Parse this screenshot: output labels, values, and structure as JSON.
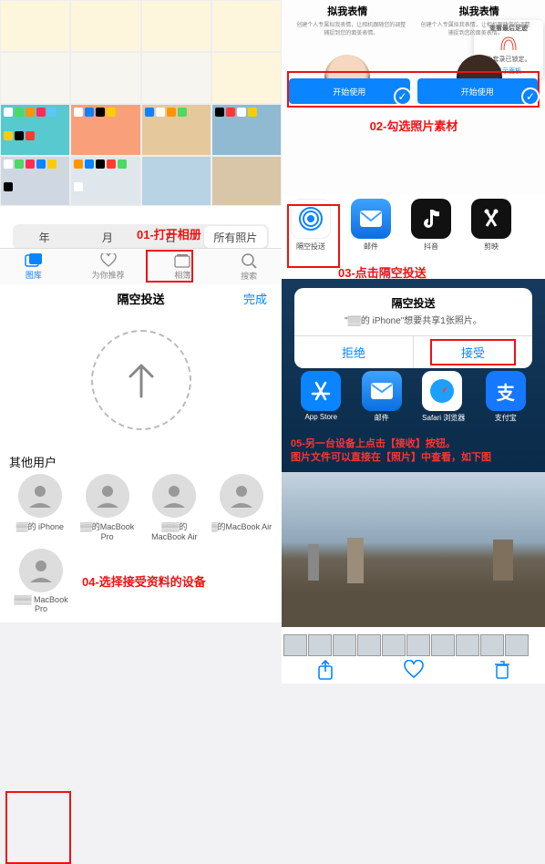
{
  "panel1": {
    "seg": {
      "year": "年",
      "month": "月",
      "day": "日",
      "all": "所有照片"
    },
    "tabs": {
      "library": "图库",
      "foryou": "为你推荐",
      "albums": "相簿",
      "search": "搜索"
    },
    "annot": "01-打开相册"
  },
  "panel2": {
    "memoji_title": "拟我表情",
    "memoji_desc": "创建个人专属拟我表情，让相机跟随您的调整捕捉到您的面美表情。",
    "btn_label": "开始使用",
    "popover_title": "查看最后足迹",
    "popover_body": "此套录已锁定。",
    "popover_link": "显示面板",
    "annot": "02-勾选照片素材"
  },
  "panel3": {
    "items": [
      {
        "name": "airdrop",
        "label": "隔空投送",
        "bg": "#ffffff",
        "ring": "#0a84ff"
      },
      {
        "name": "mail",
        "label": "邮件",
        "bg": "#1a84ff"
      },
      {
        "name": "douyin",
        "label": "抖音",
        "bg": "#111111"
      },
      {
        "name": "jianying",
        "label": "剪映",
        "bg": "#111111"
      }
    ],
    "annot": "03-点击隔空投送"
  },
  "panel4": {
    "title": "隔空投送",
    "done": "完成",
    "other_users": "其他用户",
    "devices": [
      {
        "name": "▒▒的 iPhone",
        "sub": "▒▒▒"
      },
      {
        "name": "▒▒的MacBook Pro",
        "sub": ""
      },
      {
        "name": "▒▒▒的 MacBook Air",
        "sub": ""
      },
      {
        "name": "▒的MacBook Air",
        "sub": ""
      },
      {
        "name": "▒▒▒ MacBook Pro",
        "sub": ""
      }
    ],
    "annot": "04-选择接受资料的设备"
  },
  "panel5": {
    "dlg_title": "隔空投送",
    "dlg_msg": "\"▒▒的 iPhone\"想要共享1张照片。",
    "decline": "拒绝",
    "accept": "接受",
    "apps": [
      {
        "label": "App Store",
        "bg": "#0a84ff"
      },
      {
        "label": "邮件",
        "bg": "#1a84ff"
      },
      {
        "label": "Safari 浏览器",
        "bg": "#ffffff"
      },
      {
        "label": "支付宝",
        "bg": "#1677ff"
      }
    ],
    "annot_line1": "05-另一台设备上点击【接收】按钮。",
    "annot_line2": "图片文件可以直接在【照片】中查看，如下图"
  },
  "icons": {
    "arrow_up": "↑",
    "share": "□↑",
    "heart": "♡",
    "trash": "🗑",
    "search": "🔍"
  }
}
